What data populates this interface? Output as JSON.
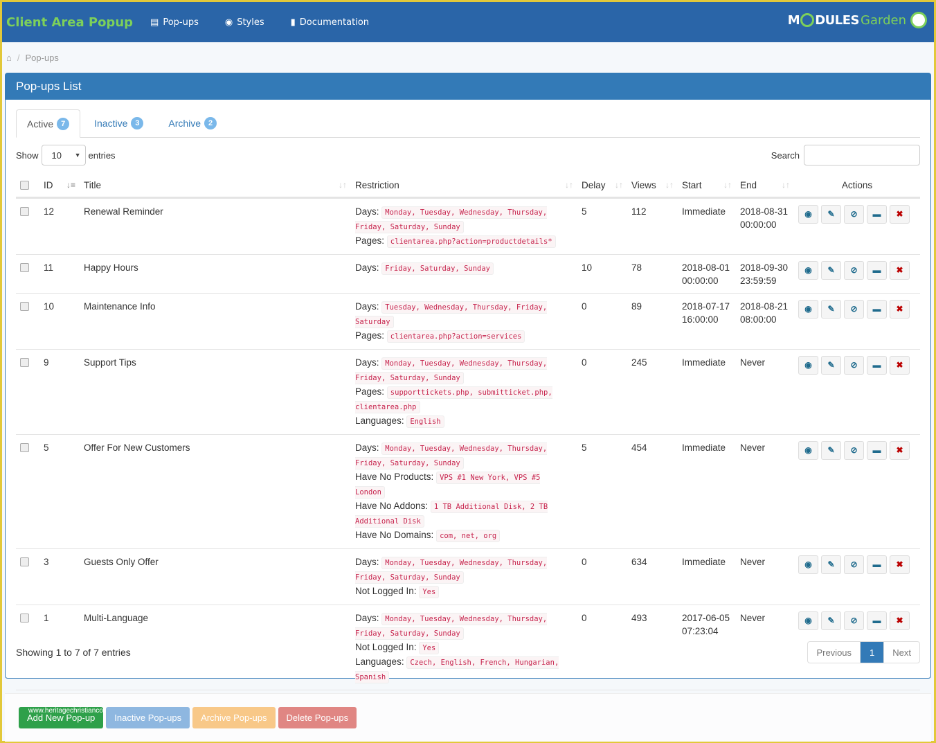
{
  "header": {
    "brand": "Client Area Popup",
    "nav": [
      {
        "label": "Pop-ups",
        "icon": "list-icon"
      },
      {
        "label": "Styles",
        "icon": "eye-icon"
      },
      {
        "label": "Documentation",
        "icon": "book-icon"
      }
    ],
    "logo": {
      "part1": "M",
      "part2": "DULES",
      "part3": "Garden"
    }
  },
  "breadcrumb": {
    "home_icon": "home-icon",
    "current": "Pop-ups"
  },
  "panel": {
    "title": "Pop-ups List",
    "tabs": [
      {
        "label": "Active",
        "count": "7",
        "active": true
      },
      {
        "label": "Inactive",
        "count": "3"
      },
      {
        "label": "Archive",
        "count": "2"
      }
    ],
    "show_label": "Show",
    "entries_value": "10",
    "entries_label": "entries",
    "search_label": "Search",
    "search_value": ""
  },
  "table": {
    "columns": [
      "ID",
      "Title",
      "Restriction",
      "Delay",
      "Views",
      "Start",
      "End",
      "Actions"
    ],
    "rows": [
      {
        "id": "12",
        "title": "Renewal Reminder",
        "restrictions": [
          {
            "label": "Days:",
            "value": "Monday, Tuesday, Wednesday, Thursday, Friday, Saturday, Sunday"
          },
          {
            "label": "Pages:",
            "value": "clientarea.php?action=productdetails*"
          }
        ],
        "delay": "5",
        "views": "112",
        "start": "Immediate",
        "end": "2018-08-31 00:00:00"
      },
      {
        "id": "11",
        "title": "Happy Hours",
        "restrictions": [
          {
            "label": "Days:",
            "value": "Friday, Saturday, Sunday"
          }
        ],
        "delay": "10",
        "views": "78",
        "start": "2018-08-01 00:00:00",
        "end": "2018-09-30 23:59:59"
      },
      {
        "id": "10",
        "title": "Maintenance Info",
        "restrictions": [
          {
            "label": "Days:",
            "value": "Tuesday, Wednesday, Thursday, Friday, Saturday"
          },
          {
            "label": "Pages:",
            "value": "clientarea.php?action=services"
          }
        ],
        "delay": "0",
        "views": "89",
        "start": "2018-07-17 16:00:00",
        "end": "2018-08-21 08:00:00"
      },
      {
        "id": "9",
        "title": "Support Tips",
        "restrictions": [
          {
            "label": "Days:",
            "value": "Monday, Tuesday, Wednesday, Thursday, Friday, Saturday, Sunday"
          },
          {
            "label": "Pages:",
            "value": "supporttickets.php, submitticket.php, clientarea.php"
          },
          {
            "label": "Languages:",
            "value": "English"
          }
        ],
        "delay": "0",
        "views": "245",
        "start": "Immediate",
        "end": "Never"
      },
      {
        "id": "5",
        "title": "Offer For New Customers",
        "restrictions": [
          {
            "label": "Days:",
            "value": "Monday, Tuesday, Wednesday, Thursday, Friday, Saturday, Sunday"
          },
          {
            "label": "Have No Products:",
            "value": "VPS #1 New York, VPS #5 London"
          },
          {
            "label": "Have No Addons:",
            "value": "1 TB Additional Disk, 2 TB Additional Disk"
          },
          {
            "label": "Have No Domains:",
            "value": "com, net, org"
          }
        ],
        "delay": "5",
        "views": "454",
        "start": "Immediate",
        "end": "Never"
      },
      {
        "id": "3",
        "title": "Guests Only Offer",
        "restrictions": [
          {
            "label": "Days:",
            "value": "Monday, Tuesday, Wednesday, Thursday, Friday, Saturday, Sunday"
          },
          {
            "label": "Not Logged In:",
            "value": "Yes"
          }
        ],
        "delay": "0",
        "views": "634",
        "start": "Immediate",
        "end": "Never"
      },
      {
        "id": "1",
        "title": "Multi-Language",
        "restrictions": [
          {
            "label": "Days:",
            "value": "Monday, Tuesday, Wednesday, Thursday, Friday, Saturday, Sunday"
          },
          {
            "label": "Not Logged In:",
            "value": "Yes"
          },
          {
            "label": "Languages:",
            "value": "Czech, English, French, Hungarian, Spanish"
          }
        ],
        "delay": "0",
        "views": "493",
        "start": "2017-06-05 07:23:04",
        "end": "Never"
      }
    ],
    "action_icons": [
      "eye-icon",
      "pencil-icon",
      "ban-icon",
      "folder-open-icon",
      "close-icon"
    ]
  },
  "footer": {
    "info": "Showing 1 to 7 of 7 entries",
    "prev": "Previous",
    "page": "1",
    "next": "Next"
  },
  "bottom_buttons": {
    "add": "Add New Pop-up",
    "inactive": "Inactive Pop-ups",
    "archive": "Archive Pop-ups",
    "delete": "Delete Pop-ups",
    "watermark": "www.heritagechristiancollege.com"
  }
}
